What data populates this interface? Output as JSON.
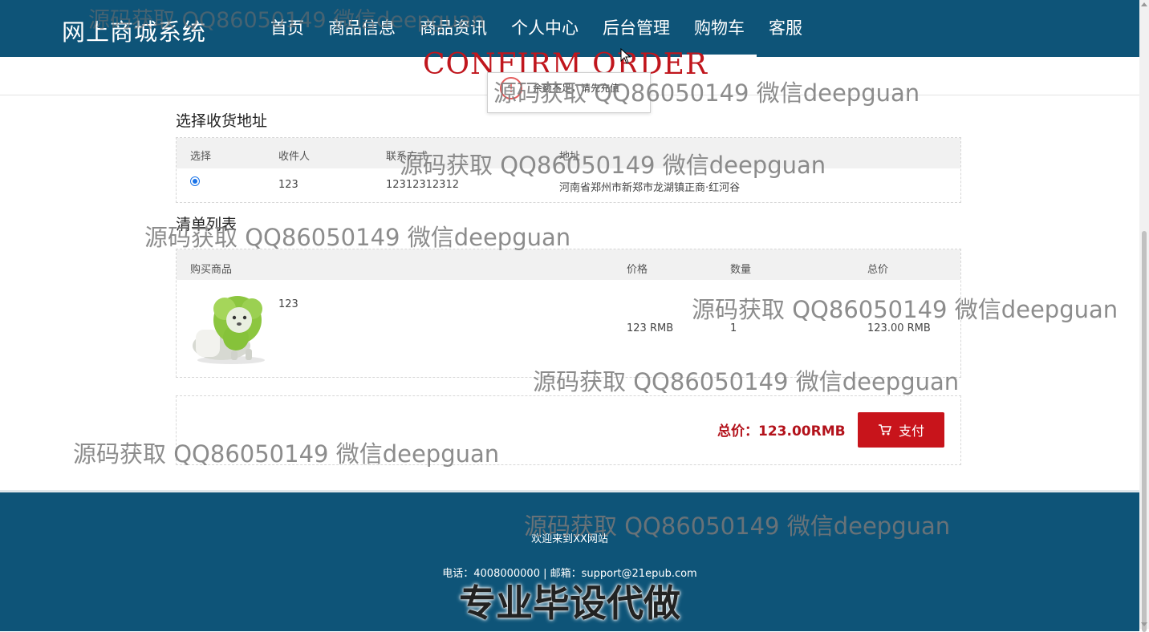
{
  "header": {
    "brand": "网上商城系统",
    "nav": [
      "首页",
      "商品信息",
      "商品资讯",
      "个人中心",
      "后台管理",
      "购物车",
      "客服"
    ],
    "active_index": 5
  },
  "page_heading": "CONFIRM ORDER",
  "popup": {
    "icon": "warning-icon",
    "text": "余额不足，请先充值"
  },
  "address": {
    "title": "选择收货地址",
    "headers": [
      "选择",
      "收件人",
      "联系方式",
      "地址"
    ],
    "rows": [
      {
        "name": "123",
        "phone": "12312312312",
        "address": "河南省郑州市新郑市龙湖镇正商·红河谷"
      }
    ]
  },
  "order": {
    "title": "清单列表",
    "headers": [
      "购买商品",
      "价格",
      "数量",
      "总价"
    ],
    "items": [
      {
        "name": "123",
        "price": "123 RMB",
        "qty": "1",
        "total": "123.00 RMB"
      }
    ]
  },
  "summary": {
    "total_label": "总价：123.00RMB",
    "pay_label": "支付"
  },
  "footer": {
    "welcome": "欢迎来到XX网站",
    "contact": "电话：4008000000 | 邮箱：support@21epub.com",
    "banner": "专业毕设代做"
  },
  "watermark": {
    "top": "源码获取 QQ86050149 微信deepguan",
    "text": "源码获取 QQ86050149 微信deepguan"
  },
  "colors": {
    "header_bg": "#0e5478",
    "accent_red": "#c8141b"
  }
}
